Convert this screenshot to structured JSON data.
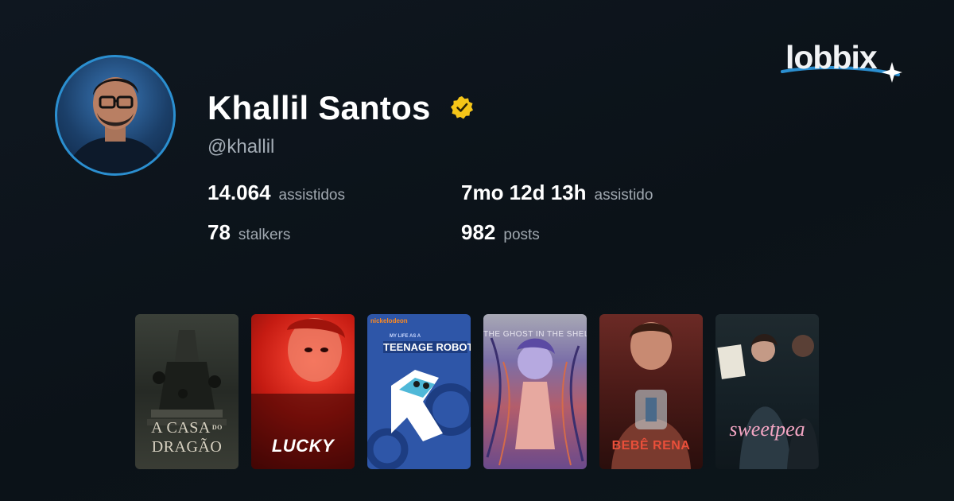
{
  "profile": {
    "name": "Khallil Santos",
    "handle": "@khallil",
    "verified_color": "#f5c518"
  },
  "stats": [
    {
      "value": "14.064",
      "label": "assistidos"
    },
    {
      "value": "7mo 12d 13h",
      "label": "assistido"
    },
    {
      "value": "78",
      "label": "stalkers"
    },
    {
      "value": "982",
      "label": "posts"
    }
  ],
  "brand": {
    "logo_text": "lobbix",
    "accent": "#2b8fd0"
  },
  "posters": [
    {
      "title_line1": "A CASA",
      "title_small": "DO",
      "title_line2": "DRAGÃO"
    },
    {
      "title": "LUCKY"
    },
    {
      "network": "nickelodeon",
      "title": "TEENAGE ROBOT",
      "subtitle": "MY LIFE AS A"
    },
    {
      "title": "THE GHOST IN THE SHELL"
    },
    {
      "title": "BEBÊ RENA"
    },
    {
      "title": "sweetpea"
    }
  ]
}
